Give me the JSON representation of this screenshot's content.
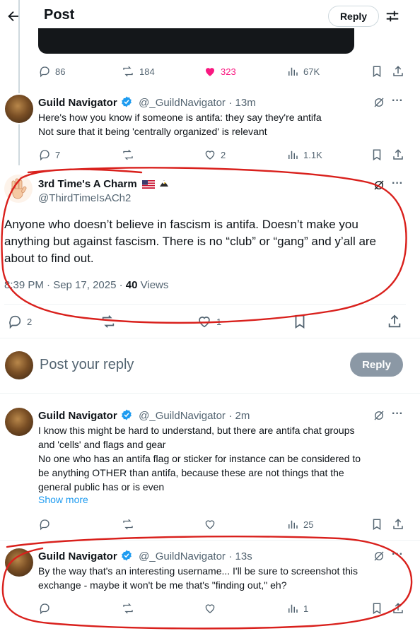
{
  "header": {
    "title": "Post",
    "reply_button": "Reply"
  },
  "parent_actions": {
    "replies": "86",
    "reposts": "184",
    "likes": "323",
    "views": "67K"
  },
  "reply1": {
    "name": "Guild Navigator",
    "handle": "@_GuildNavigator",
    "time": "· 13m",
    "text_line1": "Here's how you know if someone is antifa: they say they're antifa",
    "text_line2": "Not sure that it being 'centrally organized' is relevant",
    "replies": "7",
    "likes": "2",
    "views": "1.1K"
  },
  "main": {
    "name": "3rd Time's A Charm",
    "handle": "@ThirdTimeIsACh2",
    "text": "Anyone who doesn’t believe in fascism is antifa. Doesn’t make you anything but against fascism. There is no “club” or “gang” and y’all are about to find out.",
    "timestamp": "8:39 PM · Sep 17, 2025 · ",
    "views_count": "40",
    "views_label": " Views",
    "replies": "2",
    "likes": "1"
  },
  "composer": {
    "placeholder": "Post your reply",
    "reply_button": "Reply"
  },
  "reply2": {
    "name": "Guild Navigator",
    "handle": "@_GuildNavigator",
    "time": "· 2m",
    "line1": "I know this might be hard to understand, but there are antifa chat groups",
    "line2": "and 'cells' and flags and gear",
    "line3": "No one who has an antifa flag or sticker for instance can be considered to",
    "line4": "be anything OTHER than antifa, because these are not things that the",
    "line5": "general public has or is even",
    "show_more": "Show more",
    "views": "25"
  },
  "reply3": {
    "name": "Guild Navigator",
    "handle": "@_GuildNavigator",
    "time": "· 13s",
    "line1": "By the way that's an interesting username... I'll be sure to screenshot this",
    "line2": "exchange - maybe it won't be me that's \"finding out,\" eh?",
    "views": "1"
  },
  "colors": {
    "accent_blue": "#1d9bf0",
    "like_pink": "#f91880",
    "annotation_red": "#d9201c",
    "muted": "#536471"
  }
}
